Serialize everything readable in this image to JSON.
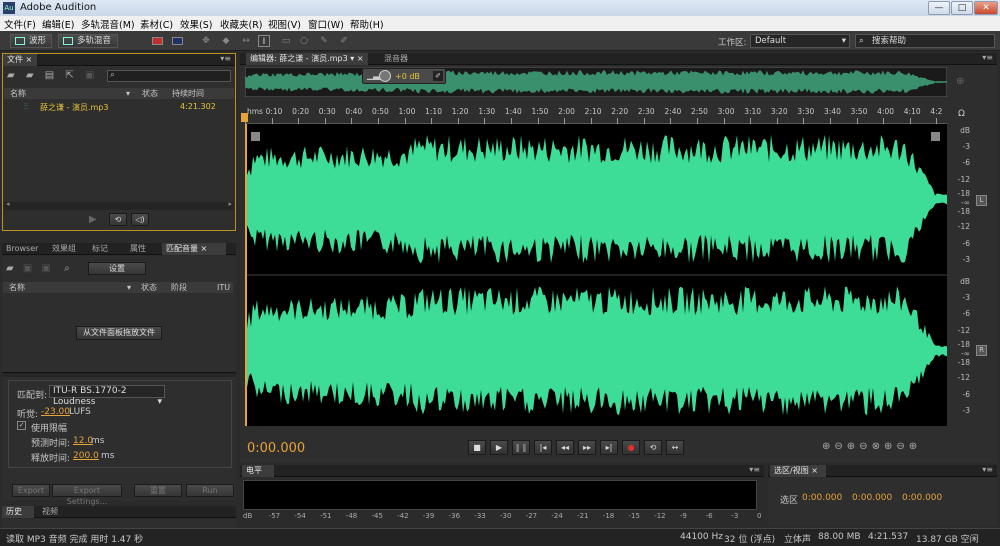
{
  "app": {
    "title": "Adobe Audition",
    "icon": "Au"
  },
  "window_controls": [
    "—",
    "□",
    "✕"
  ],
  "menu": [
    "文件(F)",
    "编辑(E)",
    "多轨混音(M)",
    "素材(C)",
    "效果(S)",
    "收藏夹(R)",
    "视图(V)",
    "窗口(W)",
    "帮助(H)"
  ],
  "toolbar": {
    "waveform_btn": "波形",
    "multitrack_btn": "多轨混音",
    "workspace_label": "工作区:",
    "workspace_value": "Default",
    "help_search": "搜索帮助"
  },
  "files_panel": {
    "tab": "文件",
    "columns": [
      "名称",
      "状态",
      "持续时间"
    ],
    "file": {
      "name": "薛之谦 - 演员.mp3",
      "duration": "4:21.302"
    }
  },
  "lower_tabs": [
    "Browser",
    "效果组",
    "标记",
    "属性",
    "匹配音量"
  ],
  "match_panel": {
    "settings_btn": "设置",
    "columns": [
      "名称",
      "状态",
      "阶段",
      "ITU"
    ],
    "drop_hint": "从文件面板拖放文件",
    "match_to_label": "匹配到:",
    "match_to_value": "ITU-R BS.1770-2 Loudness",
    "loudness_label": "听觉:",
    "loudness_value": "-23.00",
    "loudness_unit": "LUFS",
    "limit_label": "使用限幅",
    "lookahead_label": "预测时间:",
    "lookahead_value": "12.0",
    "lookahead_unit": "ms",
    "release_label": "释放时间:",
    "release_value": "200.0",
    "release_unit": "ms",
    "buttons": [
      "Export",
      "Export Settings...",
      "重置",
      "Run"
    ]
  },
  "bottom_tabs": [
    "历史",
    "视频"
  ],
  "editor": {
    "tab": "编辑器: 薛之谦 - 演员.mp3",
    "tab2": "混音器",
    "hud_gain": "+0 dB",
    "timeline_ticks": [
      "hms",
      "0:10",
      "0:20",
      "0:30",
      "0:40",
      "0:50",
      "1:00",
      "1:10",
      "1:20",
      "1:30",
      "1:40",
      "1:50",
      "2:00",
      "2:10",
      "2:20",
      "2:30",
      "2:40",
      "2:50",
      "3:00",
      "3:10",
      "3:20",
      "3:30",
      "3:40",
      "3:50",
      "4:00",
      "4:10",
      "4:2"
    ],
    "db_scale": [
      "dB",
      "-3",
      "-6",
      "-12",
      "-18",
      "-∞",
      "-18",
      "-12",
      "-6",
      "-3"
    ],
    "channel_L": "L",
    "channel_R": "R",
    "wave_color": "#3ddc97",
    "current_time": "0:00.000"
  },
  "levels_panel": {
    "tab": "电平",
    "scale": [
      "dB",
      "-57",
      "-54",
      "-51",
      "-48",
      "-45",
      "-42",
      "-39",
      "-36",
      "-33",
      "-30",
      "-27",
      "-24",
      "-21",
      "-18",
      "-15",
      "-12",
      "-9",
      "-6",
      "-3",
      "0"
    ]
  },
  "selection_panel": {
    "tab": "选区/视图",
    "row_label": "选区",
    "values": [
      "0:00.000",
      "0:00.000",
      "0:00.000"
    ]
  },
  "status_bar": {
    "left": "读取 MP3 音频 完成 用时 1.47 秒",
    "sample_rate": "44100 Hz",
    "bit_depth": "32 位 (浮点)",
    "channels": "立体声",
    "size": "88.00 MB",
    "duration": "4:21.537",
    "free": "13.87 GB 空闲"
  }
}
